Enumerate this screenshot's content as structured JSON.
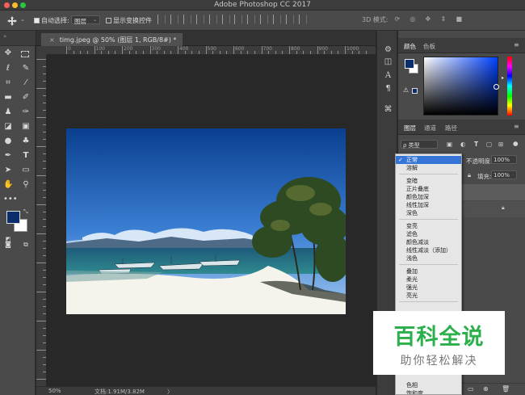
{
  "window": {
    "title": "Adobe Photoshop CC 2017"
  },
  "options_bar": {
    "auto_select_label": "自动选择:",
    "auto_select_value": "图层",
    "show_transform_label": "显示变换控件",
    "mode3d_label": "3D 模式:"
  },
  "document": {
    "tab_label": "timg.jpeg @ 50% (图层 1, RGB/8#) *",
    "close_glyph": "×"
  },
  "rulers": {
    "h_labels": [
      "0",
      "100",
      "200",
      "300",
      "400",
      "500",
      "600",
      "700",
      "800",
      "900",
      "1000"
    ]
  },
  "status": {
    "zoom": "50%",
    "doc_info": "文档:1.91M/3.82M",
    "arrow": "〉"
  },
  "panels": {
    "color_tabs": [
      "颜色",
      "色板"
    ],
    "layers_tabs": [
      "图层",
      "通道",
      "路径"
    ],
    "kind_filter": "ρ 类型",
    "opacity_label": "不透明度:",
    "opacity_value": "100%",
    "fill_label": "填充:",
    "fill_value": "100%",
    "lock_label": "锁"
  },
  "blend_modes": {
    "check_glyph": "✓",
    "groups": [
      [
        "正常",
        "溶解"
      ],
      [
        "变暗",
        "正片叠底",
        "颜色加深",
        "线性加深",
        "深色"
      ],
      [
        "变亮",
        "滤色",
        "颜色减淡",
        "线性减淡（添加）",
        "浅色"
      ],
      [
        "叠加",
        "柔光",
        "强光",
        "亮光"
      ],
      [
        "色相",
        "饱和度"
      ]
    ],
    "selected": "正常"
  },
  "colors": {
    "foreground": "#0c2d6b",
    "background": "#ffffff",
    "accent_selection": "#3675d8",
    "watermark_green": "#2bb04b"
  },
  "watermark": {
    "title": "百科全说",
    "subtitle": "助你轻松解决"
  },
  "icons": {
    "move": "move-tool-icon",
    "marquee": "marquee-tool-icon",
    "lasso": "lasso-tool-icon",
    "quick_select": "quick-select-tool-icon",
    "crop": "crop-tool-icon",
    "eyedropper": "eyedropper-tool-icon",
    "healing": "healing-brush-icon",
    "brush": "brush-tool-icon",
    "stamp": "clone-stamp-icon",
    "history_brush": "history-brush-icon",
    "eraser": "eraser-tool-icon",
    "gradient": "gradient-tool-icon",
    "blur": "blur-tool-icon",
    "dodge": "dodge-tool-icon",
    "pen": "pen-tool-icon",
    "type": "type-tool-icon",
    "path_select": "path-selection-icon",
    "shape": "rectangle-tool-icon",
    "hand": "hand-tool-icon",
    "zoom": "zoom-tool-icon"
  }
}
